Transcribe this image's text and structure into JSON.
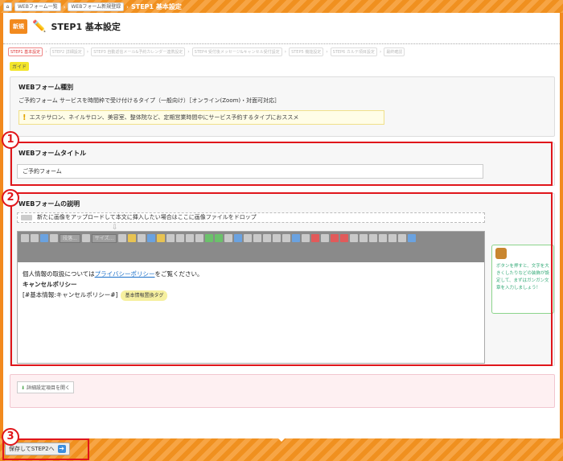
{
  "breadcrumbs": [
    "WEBフォーム一覧",
    "WEBフォーム新規登録"
  ],
  "breadcrumb_current": "STEP1 基本設定",
  "header": {
    "badge": "新規",
    "title": "STEP1 基本設定"
  },
  "steps": [
    "STEP1 基本設定",
    "STEP2 詳細設定",
    "STEP3 自動返信メール&予約カレンダー連携設定",
    "STEP4 受付後メッセージ&キャンセル受付設定",
    "STEP5 機能設定",
    "STEP6 カルテ項目設定",
    "最終確認"
  ],
  "guide": "ガイド",
  "form_type": {
    "title": "WEBフォーム種別",
    "desc": "ご予約フォーム サービスを時間枠で受け付けるタイプ（一般向け）［オンライン(Zoom)・対面可対応］",
    "notice": "エステサロン、ネイルサロン、美容室、整体院など、定期営業時間中にサービス予約するタイプにおススメ"
  },
  "form_title": {
    "title": "WEBフォームタイトル",
    "value": "ご予約フォーム"
  },
  "form_desc": {
    "title": "WEBフォームの説明",
    "drop": "新たに画像をアップロードして本文に挿入したい場合はここに画像ファイルをドロップ",
    "style_select": "段落...",
    "size_select": "サイズ...",
    "line1_pre": "個人情報の取扱については",
    "line1_link": "プライバシーポリシー",
    "line1_post": "をご覧ください。",
    "line2": "キャンセルポリシー",
    "line3": "[#基本情報:キャンセルポリシー#]",
    "tag": "基本情報置換タグ"
  },
  "tooltip": "ボタンを押すと、文字を大きくしたりなどの装飾が設定して、まずはガンガン文章を入力しましょう！",
  "detail_button": "詳細設定項目を開く",
  "save_button": "保存してSTEP2へ",
  "callouts": [
    "1",
    "2",
    "3"
  ]
}
